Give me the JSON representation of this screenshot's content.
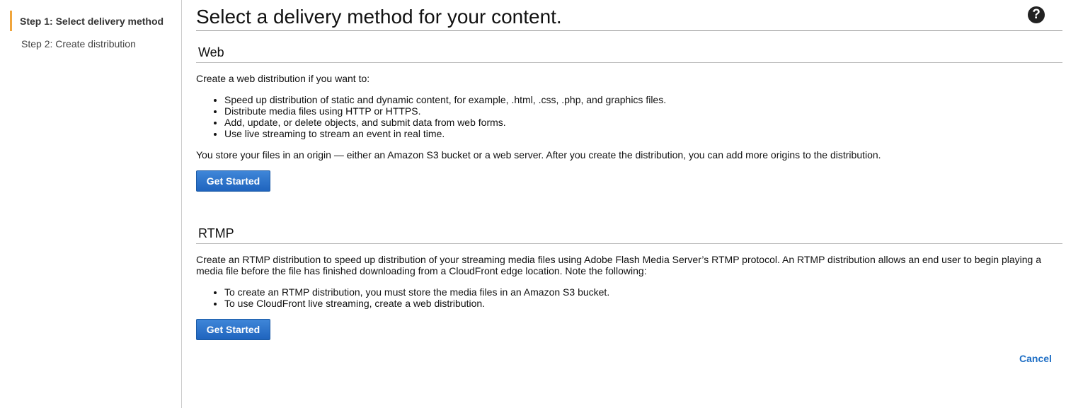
{
  "steps": [
    {
      "label": "Step 1: Select delivery method"
    },
    {
      "label": "Step 2: Create distribution"
    }
  ],
  "page_title": "Select a delivery method for your content.",
  "help_icon": {
    "glyph": "?"
  },
  "web": {
    "heading": "Web",
    "intro": "Create a web distribution if you want to:",
    "bullets": [
      "Speed up distribution of static and dynamic content, for example, .html, .css, .php, and graphics files.",
      "Distribute media files using HTTP or HTTPS.",
      "Add, update, or delete objects, and submit data from web forms.",
      "Use live streaming to stream an event in real time."
    ],
    "note": "You store your files in an origin — either an Amazon S3 bucket or a web server. After you create the distribution, you can add more origins to the distribution.",
    "button": "Get Started"
  },
  "rtmp": {
    "heading": "RTMP",
    "intro": "Create an RTMP distribution to speed up distribution of your streaming media files using Adobe Flash Media Server’s RTMP protocol. An RTMP distribution allows an end user to begin playing a media file before the file has finished downloading from a CloudFront edge location. Note the following:",
    "bullets": [
      "To create an RTMP distribution, you must store the media files in an Amazon S3 bucket.",
      "To use CloudFront live streaming, create a web distribution."
    ],
    "button": "Get Started"
  },
  "cancel": "Cancel",
  "colors": {
    "accent_step": "#f0a53c",
    "button_blue": "#1f64be",
    "link_blue": "#1f6fc5"
  }
}
